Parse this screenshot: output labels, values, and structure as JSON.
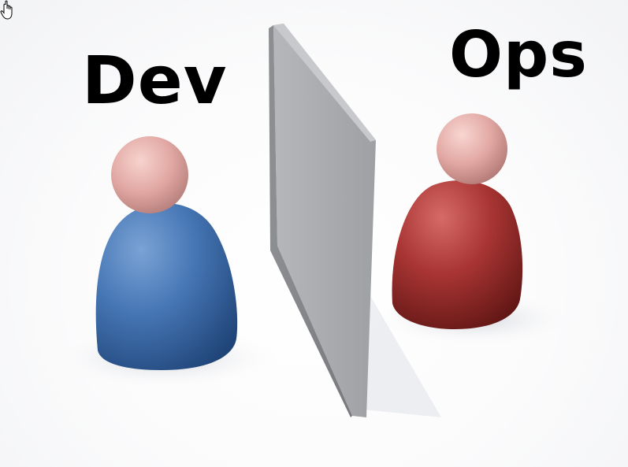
{
  "labels": {
    "left": "Dev",
    "right": "Ops"
  },
  "figures": {
    "left_body_color": "#3f6fae",
    "left_head_color": "#e2a9a4",
    "right_body_color": "#a2302f",
    "right_head_color": "#e3a9a4",
    "wall_color": "#a7a9ac"
  },
  "cursor": {
    "icon": "hand-pointer-icon"
  }
}
